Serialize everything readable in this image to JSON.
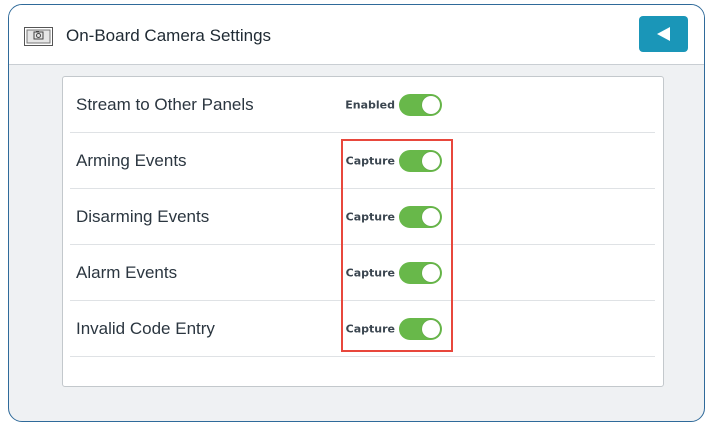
{
  "header": {
    "title": "On-Board Camera Settings",
    "icon": "camera-icon",
    "back_icon": "back-arrow-icon"
  },
  "settings": [
    {
      "label": "Stream to Other Panels",
      "status": "Enabled",
      "on": true
    },
    {
      "label": "Arming Events",
      "status": "Capture",
      "on": true
    },
    {
      "label": "Disarming Events",
      "status": "Capture",
      "on": true
    },
    {
      "label": "Alarm Events",
      "status": "Capture",
      "on": true
    },
    {
      "label": "Invalid Code Entry",
      "status": "Capture",
      "on": true
    }
  ],
  "colors": {
    "accent": "#1a96b8",
    "toggle_on": "#68b84a",
    "highlight": "#e8473c",
    "frame_border": "#2f6a9a"
  }
}
